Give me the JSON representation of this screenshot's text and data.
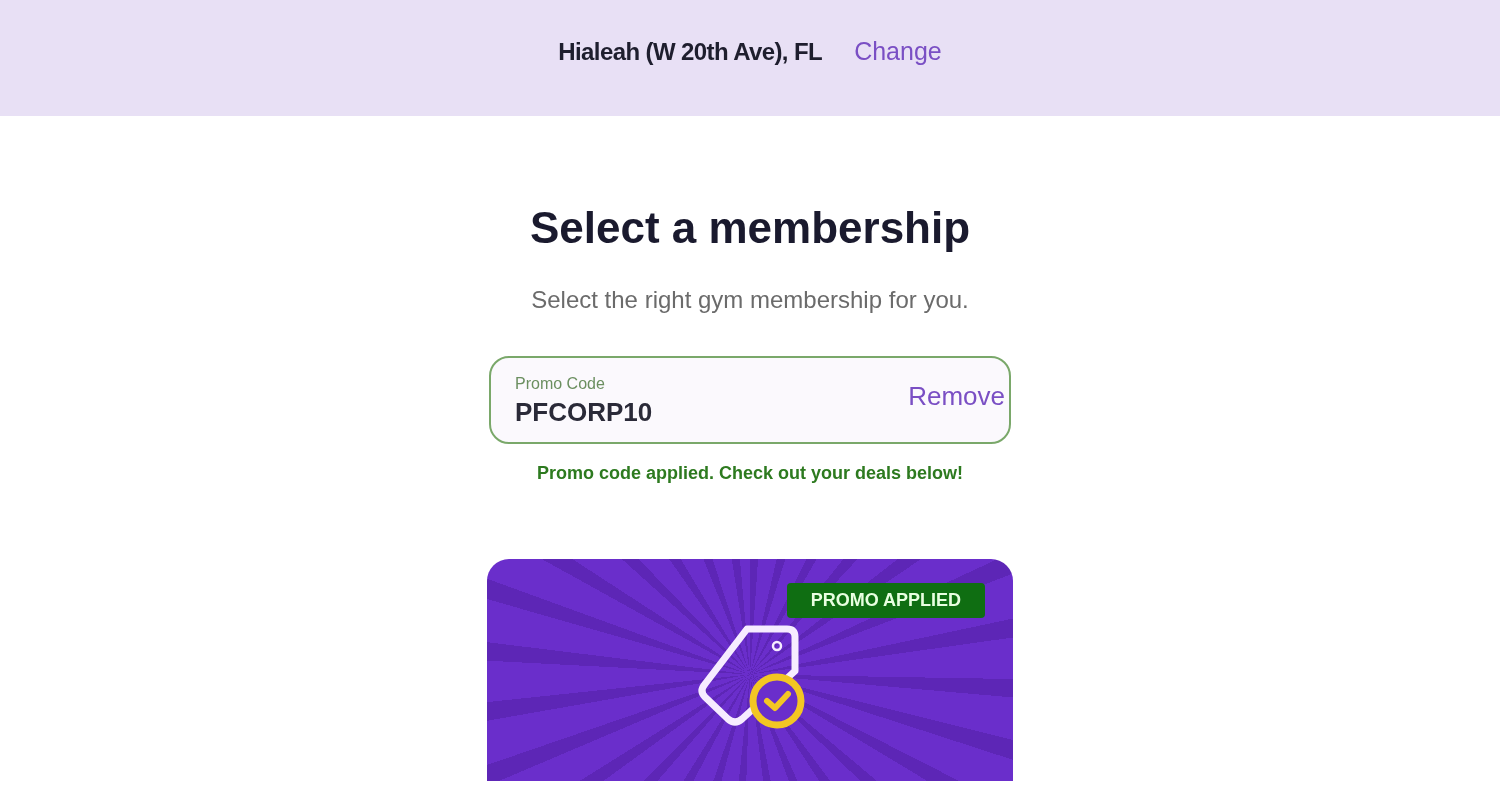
{
  "location_bar": {
    "location": "Hialeah (W 20th Ave), FL",
    "change_link": "Change"
  },
  "heading": "Select a membership",
  "subtitle": "Select the right gym membership for you.",
  "promo_field": {
    "label": "Promo Code",
    "value": "PFCORP10",
    "remove_link": "Remove"
  },
  "promo_message": "Promo code applied. Check out your deals below!",
  "promo_card": {
    "badge": "PROMO APPLIED"
  }
}
